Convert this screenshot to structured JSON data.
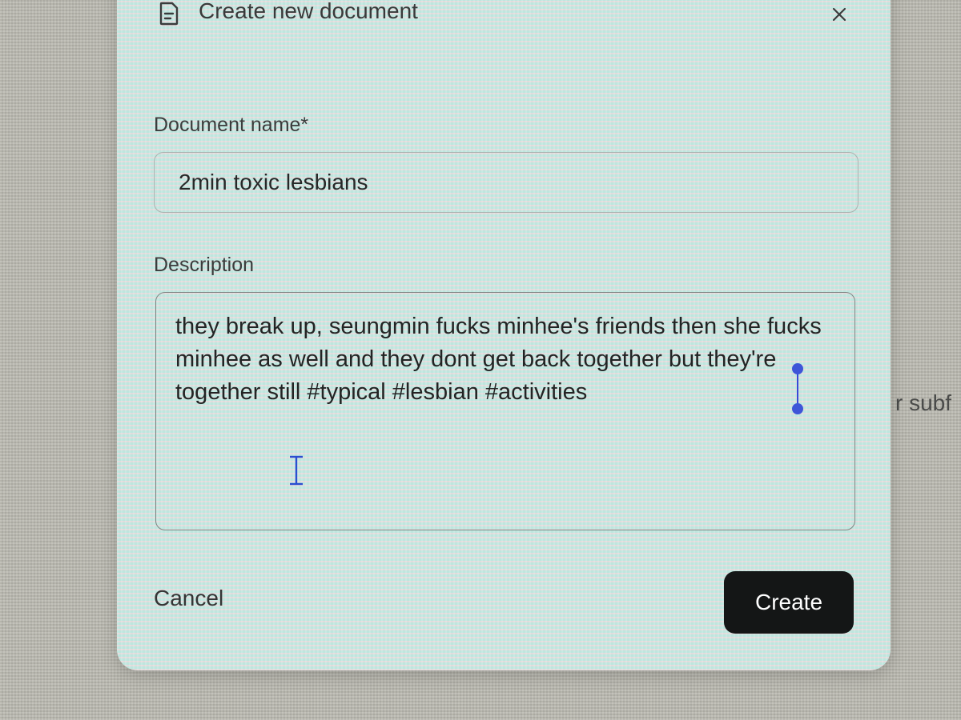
{
  "dialog": {
    "title": "Create new document",
    "icon": "document-icon",
    "close_icon": "close-icon"
  },
  "form": {
    "name_label": "Document name*",
    "name_value": "2min toxic lesbians",
    "description_label": "Description",
    "description_value": "they break up, seungmin fucks minhee's friends then she fucks minhee as well and they dont get back together but they're together still #typical #lesbian #activities"
  },
  "actions": {
    "cancel_label": "Cancel",
    "create_label": "Create"
  },
  "background": {
    "peek_text": "r subf"
  },
  "colors": {
    "dialog_bg": "#c9e4dd",
    "primary_button": "#141616",
    "selection_handle": "#3e55d8"
  }
}
